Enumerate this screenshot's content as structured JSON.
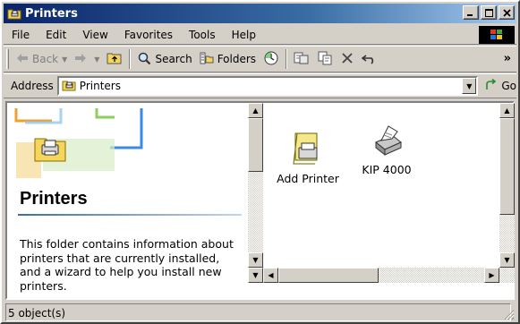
{
  "window": {
    "title": "Printers"
  },
  "menu": [
    "File",
    "Edit",
    "View",
    "Favorites",
    "Tools",
    "Help"
  ],
  "toolbar": {
    "back": "Back",
    "search": "Search",
    "folders": "Folders",
    "more": "»"
  },
  "address": {
    "label": "Address",
    "value": "Printers",
    "go": "Go"
  },
  "left_pane": {
    "title": "Printers",
    "description": "This folder contains information about printers that are currently installed, and a wizard to help you install new printers."
  },
  "items": [
    {
      "label": "Add Printer",
      "icon": "add-printer-icon"
    },
    {
      "label": "KIP 4000",
      "icon": "printer-icon"
    }
  ],
  "status": {
    "text": "5 object(s)"
  },
  "colors": {
    "titlebar_start": "#0a246a",
    "titlebar_end": "#a6caf0",
    "face": "#d4d0c8"
  }
}
